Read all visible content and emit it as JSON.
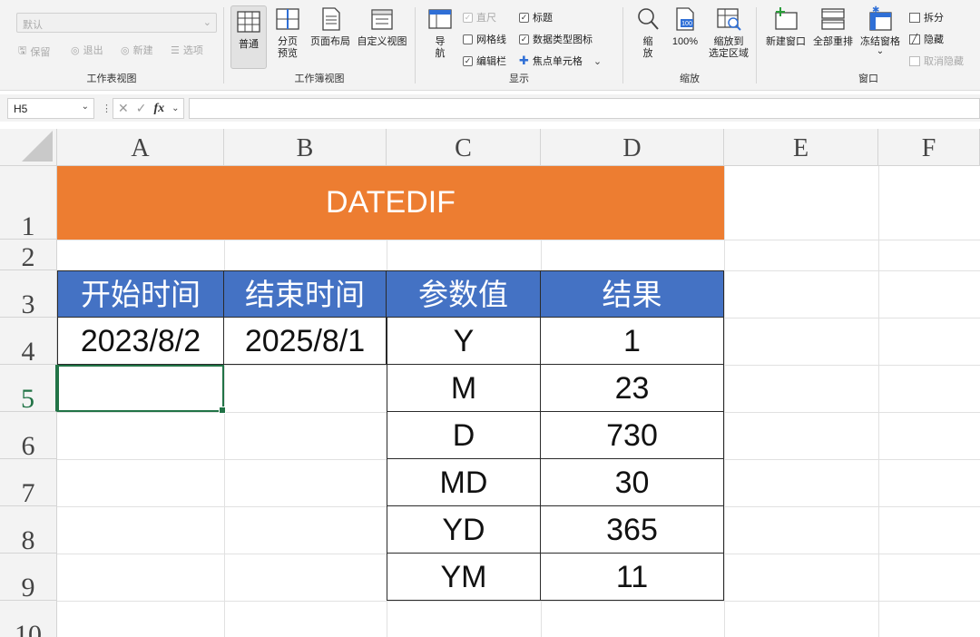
{
  "ribbon": {
    "view_selector": {
      "placeholder": "默认",
      "arrow": "⌄"
    },
    "sheet_view": {
      "items": [
        "保留",
        "退出",
        "新建",
        "选项"
      ],
      "label": "工作表视图"
    },
    "workbook_views": {
      "items": [
        "普通",
        "分页\n预览",
        "页面布局",
        "自定义视图"
      ],
      "label": "工作簿视图"
    },
    "show": {
      "nav": "导\n航",
      "checks": [
        {
          "label": "直尺",
          "checked": true,
          "disabled": true
        },
        {
          "label": "网格线",
          "checked": false,
          "disabled": false
        },
        {
          "label": "编辑栏",
          "checked": true,
          "disabled": false
        },
        {
          "label": "标题",
          "checked": true,
          "disabled": false
        },
        {
          "label": "数据类型图标",
          "checked": true,
          "disabled": false
        },
        {
          "label": "焦点单元格",
          "checked": false,
          "disabled": false
        }
      ],
      "more": "⌄",
      "label": "显示"
    },
    "zoom": {
      "items": [
        "缩\n放",
        "100%",
        "缩放到\n选定区域"
      ],
      "icon_text": "100",
      "label": "缩放"
    },
    "window": {
      "items": [
        "新建窗口",
        "全部重排",
        "冻结窗格"
      ],
      "freeze_arrow": "⌄",
      "small": [
        "拆分",
        "隐藏",
        "取消隐藏"
      ],
      "label": "窗口"
    }
  },
  "formula_bar": {
    "name_box": "H5",
    "name_arrow": "⌄",
    "sep": "⋮",
    "cancel": "✕",
    "enter": "✓",
    "fx": "fx",
    "fx_arrow": "⌄",
    "content": ""
  },
  "columns": [
    "A",
    "B",
    "C",
    "D",
    "E",
    "F"
  ],
  "rows": [
    "1",
    "2",
    "3",
    "4",
    "5",
    "6",
    "7",
    "8",
    "9",
    "10"
  ],
  "active_row": "5",
  "sheet": {
    "title": "DATEDIF",
    "headers": [
      "开始时间",
      "结束时间",
      "参数值",
      "结果"
    ],
    "start_date": "2023/8/2",
    "end_date": "2025/8/1",
    "results": [
      {
        "param": "Y",
        "value": "1"
      },
      {
        "param": "M",
        "value": "23"
      },
      {
        "param": "D",
        "value": "730"
      },
      {
        "param": "MD",
        "value": "30"
      },
      {
        "param": "YD",
        "value": "365"
      },
      {
        "param": "YM",
        "value": "11"
      }
    ]
  },
  "colors": {
    "title_fill": "#ed7d31",
    "header_fill": "#4472c4",
    "selection": "#217346"
  }
}
